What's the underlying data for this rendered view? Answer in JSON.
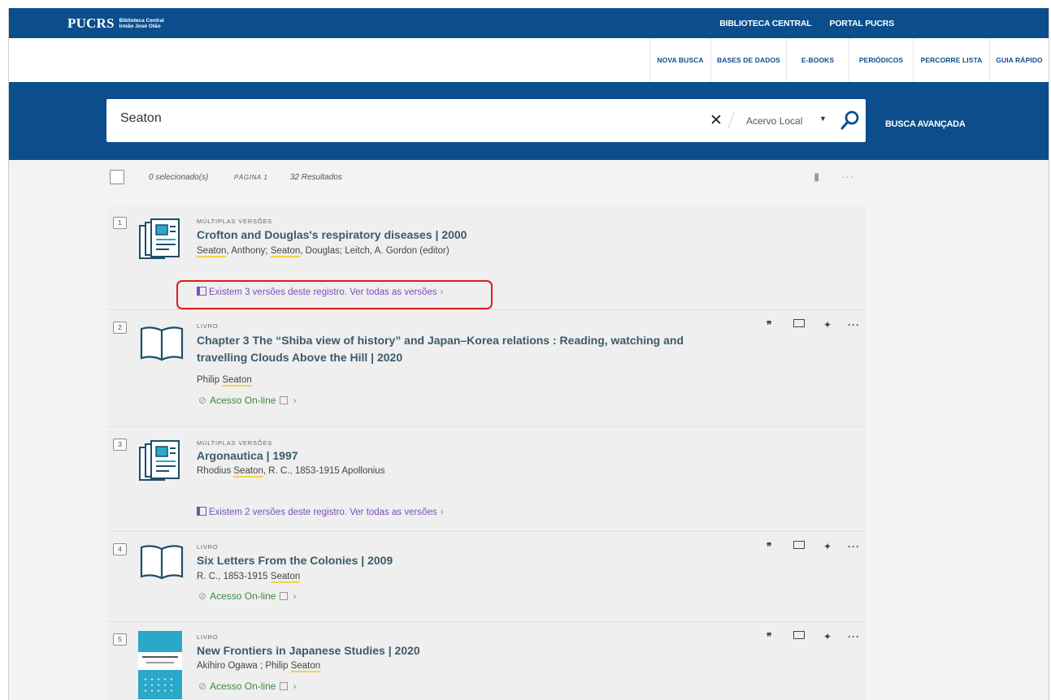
{
  "header": {
    "logo_main": "PUCRS",
    "logo_sub_line1": "Biblioteca Central",
    "logo_sub_line2": "Irmão José Otão",
    "top_links": [
      "BIBLIOTECA CENTRAL",
      "PORTAL PUCRS"
    ]
  },
  "nav": {
    "items": [
      "NOVA BUSCA",
      "BASES DE DADOS",
      "E-BOOKS",
      "PERIÓDICOS",
      "PERCORRE LISTA",
      "GUIA RÁPIDO"
    ]
  },
  "search": {
    "query": "Seaton",
    "scope": "Acervo Local",
    "advanced_label": "BUSCA AVANÇADA"
  },
  "results_header": {
    "selected": "0 selecionado(s)",
    "page": "PÁGINA 1",
    "count": "32 Resultados"
  },
  "results": [
    {
      "number": "1",
      "type": "MÚLTIPLAS VERSÕES",
      "title": "Crofton and Douglas's respiratory diseases | 2000",
      "authors_html": [
        "Seaton",
        ", Anthony; ",
        "Seaton",
        ", Douglas; Leitch, A. Gordon (editor)"
      ],
      "versions": "Existem 3 versões deste registro. Ver todas as versões"
    },
    {
      "number": "2",
      "type": "LIVRO",
      "title": "Chapter 3 The “Shiba view of history” and Japan–Korea relations : Reading, watching and travelling Clouds Above the Hill | 2020",
      "authors_html": [
        "Philip ",
        "Seaton",
        ""
      ],
      "online": "Acesso On-line"
    },
    {
      "number": "3",
      "type": "MÚLTIPLAS VERSÕES",
      "title": "Argonautica | 1997",
      "authors_html": [
        "Rhodius ",
        "Seaton",
        ", R. C., 1853-1915 Apollonius"
      ],
      "versions": "Existem 2 versões deste registro. Ver todas as versões"
    },
    {
      "number": "4",
      "type": "LIVRO",
      "title": "Six Letters From the Colonies | 2009",
      "authors_html": [
        "R. C., 1853-1915 ",
        "Seaton",
        ""
      ],
      "online": "Acesso On-line"
    },
    {
      "number": "5",
      "type": "LIVRO",
      "title": "New Frontiers in Japanese Studies | 2020",
      "authors_html": [
        "Akihiro Ogawa ; Philip ",
        "Seaton",
        ""
      ],
      "online": "Acesso On-line"
    }
  ],
  "colors": {
    "brand_blue": "#0c4e8c",
    "title_color": "#3d5a6b",
    "versions_purple": "#7b50b8",
    "online_green": "#3c8b3c",
    "highlight_red": "#e01b1b"
  }
}
